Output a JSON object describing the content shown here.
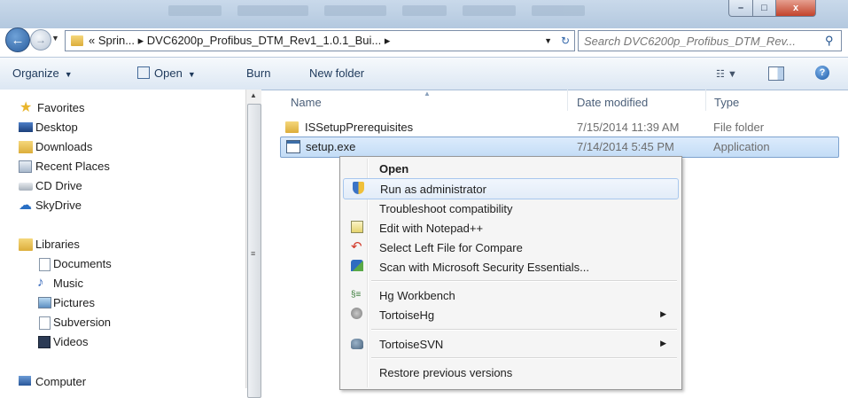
{
  "window": {
    "minimize_label": "–",
    "maximize_label": "□",
    "close_label": "x"
  },
  "address": {
    "path": "« Sprin... ▸ DVC6200p_Profibus_DTM_Rev1_1.0.1_Bui... ▸",
    "search_placeholder": "Search DVC6200p_Profibus_DTM_Rev..."
  },
  "toolbar": {
    "organize": "Organize",
    "open": "Open",
    "burn": "Burn",
    "new_folder": "New folder"
  },
  "nav": {
    "favorites": "Favorites",
    "desktop": "Desktop",
    "downloads": "Downloads",
    "recent": "Recent Places",
    "cd": "CD Drive",
    "skydrive": "SkyDrive",
    "libraries": "Libraries",
    "documents": "Documents",
    "music": "Music",
    "pictures": "Pictures",
    "subversion": "Subversion",
    "videos": "Videos",
    "computer": "Computer"
  },
  "columns": {
    "name": "Name",
    "date": "Date modified",
    "type": "Type"
  },
  "files": [
    {
      "name": "ISSetupPrerequisites",
      "date": "7/15/2014 11:39 AM",
      "type": "File folder"
    },
    {
      "name": "setup.exe",
      "date": "7/14/2014 5:45 PM",
      "type": "Application"
    }
  ],
  "context_menu": {
    "open": "Open",
    "run_admin": "Run as administrator",
    "troubleshoot": "Troubleshoot compatibility",
    "notepad": "Edit with Notepad++",
    "compare": "Select Left File for Compare",
    "scan": "Scan with Microsoft Security Essentials...",
    "hg_workbench": "Hg Workbench",
    "tortoisehg": "TortoiseHg",
    "tortoisesvn": "TortoiseSVN",
    "restore": "Restore previous versions"
  },
  "colors": {
    "selection": "#c3dcf6",
    "folder": "#dcad3b",
    "accent": "#1e395b"
  }
}
